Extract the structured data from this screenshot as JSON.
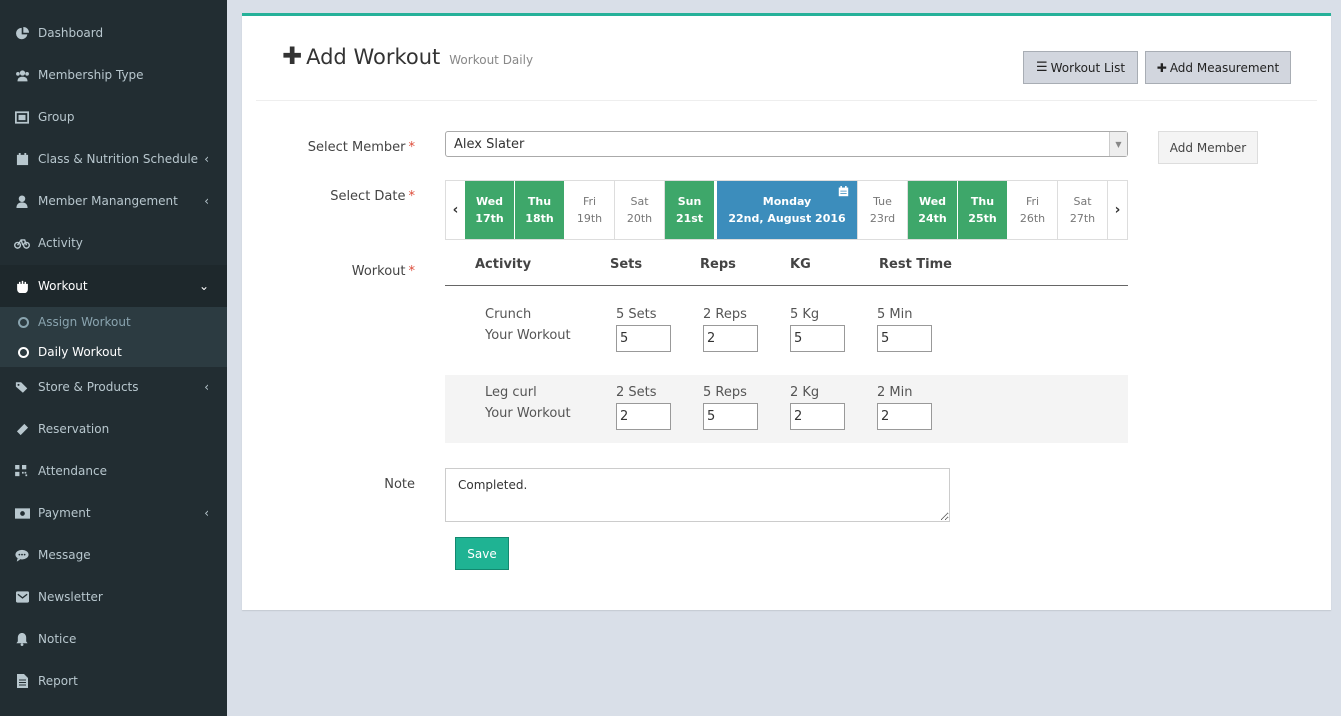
{
  "sidebar": {
    "items": [
      {
        "label": "Dashboard"
      },
      {
        "label": "Membership Type"
      },
      {
        "label": "Group"
      },
      {
        "label": "Class & Nutrition Schedule"
      },
      {
        "label": "Member Manangement"
      },
      {
        "label": "Activity"
      },
      {
        "label": "Workout"
      },
      {
        "label": "Store & Products"
      },
      {
        "label": "Reservation"
      },
      {
        "label": "Attendance"
      },
      {
        "label": "Payment"
      },
      {
        "label": "Message"
      },
      {
        "label": "Newsletter"
      },
      {
        "label": "Notice"
      },
      {
        "label": "Report"
      }
    ],
    "submenu": [
      {
        "label": "Assign Workout"
      },
      {
        "label": "Daily Workout"
      }
    ]
  },
  "header": {
    "title": "Add Workout",
    "subtitle": "Workout Daily",
    "workout_list_label": "Workout List",
    "add_measurement_label": "Add Measurement"
  },
  "form": {
    "select_member_label": "Select Member",
    "required_mark": "*",
    "member_value": "Alex Slater",
    "add_member_label": "Add Member",
    "select_date_label": "Select Date",
    "dates": [
      {
        "day": "Wed",
        "date": "17th",
        "state": "workout"
      },
      {
        "day": "Thu",
        "date": "18th",
        "state": "workout"
      },
      {
        "day": "Fri",
        "date": "19th",
        "state": "none"
      },
      {
        "day": "Sat",
        "date": "20th",
        "state": "none"
      },
      {
        "day": "Sun",
        "date": "21st",
        "state": "workout"
      },
      {
        "day": "Monday",
        "date": "22nd, August 2016",
        "state": "selected"
      },
      {
        "day": "Tue",
        "date": "23rd",
        "state": "none"
      },
      {
        "day": "Wed",
        "date": "24th",
        "state": "workout"
      },
      {
        "day": "Thu",
        "date": "25th",
        "state": "workout"
      },
      {
        "day": "Fri",
        "date": "26th",
        "state": "none"
      },
      {
        "day": "Sat",
        "date": "27th",
        "state": "none"
      }
    ],
    "workout_label": "Workout",
    "columns": [
      "Activity",
      "Sets",
      "Reps",
      "KG",
      "Rest Time"
    ],
    "workouts": [
      {
        "activity": "Crunch",
        "sub": "Your Workout",
        "sets_text": "5 Sets",
        "reps_text": "2 Reps",
        "kg_text": "5 Kg",
        "rest_text": "5 Min",
        "sets": "5",
        "reps": "2",
        "kg": "5",
        "rest": "5"
      },
      {
        "activity": "Leg curl",
        "sub": "Your Workout",
        "sets_text": "2 Sets",
        "reps_text": "5 Reps",
        "kg_text": "2 Kg",
        "rest_text": "2 Min",
        "sets": "2",
        "reps": "5",
        "kg": "2",
        "rest": "2"
      }
    ],
    "note_label": "Note",
    "note_value": "Completed.",
    "save_label": "Save"
  },
  "colors": {
    "sidebar_bg": "#222d32",
    "accent": "#25b199",
    "workout_day": "#3ea76a",
    "selected_day": "#3c8dbc"
  }
}
